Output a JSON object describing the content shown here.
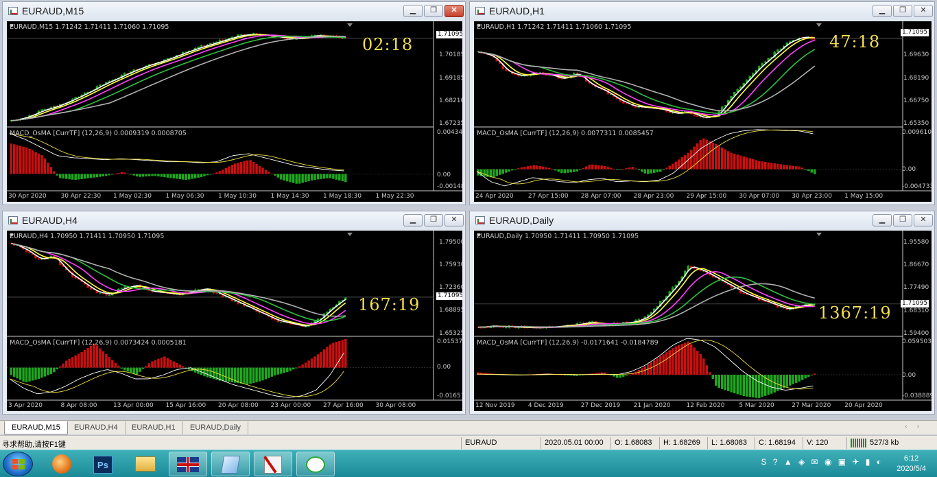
{
  "windows": [
    {
      "id": "w1",
      "title": "EURAUD,M15",
      "active": true,
      "info": "EURAUD,M15  1.71242 1.71411 1.71060 1.71095",
      "timer": "02:18",
      "price_box": "1.71095",
      "price_axis": [
        "1.70185",
        "1.69185",
        "1.68210",
        "1.67235"
      ],
      "macd_label": "MACD_OsMA [CurrTF] (12,26,9) 0.0009319 0.0008705",
      "macd_axis": [
        "0.0043417",
        "0.00",
        "-0.001481"
      ],
      "time_axis": [
        "30 Apr 2020",
        "30 Apr 22:30",
        "1 May 02:30",
        "1 May 06:30",
        "1 May 10:30",
        "1 May 14:30",
        "1 May 18:30",
        "1 May 22:30"
      ],
      "chart_data": {
        "type": "line",
        "title": "EURAUD,M15",
        "x": [
          "30 Apr 2020",
          "30 Apr 22:30",
          "1 May 02:30",
          "1 May 06:30",
          "1 May 10:30",
          "1 May 14:30",
          "1 May 18:30",
          "1 May 22:30"
        ],
        "ylim": [
          1.6724,
          1.714
        ],
        "close": [
          1.6745,
          1.6762,
          1.679,
          1.681,
          1.6838,
          1.687,
          1.6905,
          1.6935,
          1.6965,
          1.699,
          1.701,
          1.7035,
          1.706,
          1.708,
          1.71,
          1.712,
          1.7125,
          1.7118,
          1.711,
          1.7105,
          1.712,
          1.7115,
          1.7109
        ],
        "ma": [
          {
            "color": "#ffffff",
            "period_shift": 0
          },
          {
            "color": "#ffff40",
            "period_shift": 1
          },
          {
            "color": "#ff40ff",
            "period_shift": 3
          },
          {
            "color": "#30c040",
            "period_shift": 6
          },
          {
            "color": "#b0b0b0",
            "period_shift": 10
          }
        ],
        "macd_hist": [
          0.003,
          0.0026,
          0.0018,
          -0.0004,
          -0.0006,
          -0.0004,
          -0.0002,
          0.0002,
          -0.0003,
          -0.0002,
          -0.0004,
          -0.0006,
          -0.0003,
          0.0002,
          0.001,
          0.0014,
          0.0004,
          -0.0006,
          -0.001,
          -0.0006,
          -0.0004,
          -0.0008
        ],
        "macd_line": [
          0.004,
          0.0034,
          0.0026,
          0.0018,
          0.0016,
          0.0015,
          0.0014,
          0.0015,
          0.0014,
          0.0013,
          0.0012,
          0.0012,
          0.0011,
          0.0012,
          0.0018,
          0.002,
          0.0016,
          0.0012,
          0.0008,
          0.0006,
          0.0004,
          0.0003
        ],
        "macd_ylim": [
          -0.0016,
          0.0045
        ]
      }
    },
    {
      "id": "w2",
      "title": "EURAUD,H1",
      "active": false,
      "info": "EURAUD,H1  1.71242 1.71411 1.71060 1.71095",
      "timer": "47:18",
      "price_box": "1.71095",
      "price_axis": [
        "1.69630",
        "1.68190",
        "1.66750",
        "1.65350"
      ],
      "macd_label": "MACD_OsMA [CurrTF] (12,26,9) 0.0077311 0.0085457",
      "macd_axis": [
        "0.0096103",
        "0.00",
        "-0.004733"
      ],
      "time_axis": [
        "24 Apr 2020",
        "27 Apr 15:00",
        "28 Apr 07:00",
        "28 Apr 23:00",
        "29 Apr 15:00",
        "30 Apr 07:00",
        "30 Apr 23:00",
        "1 May 15:00"
      ],
      "chart_data": {
        "type": "line",
        "title": "EURAUD,H1",
        "x": [
          "24 Apr 2020",
          "27 Apr 15:00",
          "28 Apr 07:00",
          "28 Apr 23:00",
          "29 Apr 15:00",
          "30 Apr 07:00",
          "30 Apr 23:00",
          "1 May 15:00"
        ],
        "ylim": [
          1.653,
          1.716
        ],
        "close": [
          1.702,
          1.699,
          1.689,
          1.686,
          1.688,
          1.687,
          1.684,
          1.688,
          1.68,
          1.676,
          1.67,
          1.666,
          1.665,
          1.664,
          1.661,
          1.662,
          1.658,
          1.66,
          1.672,
          1.682,
          1.692,
          1.7,
          1.708,
          1.712,
          1.711
        ],
        "ma": [
          {
            "color": "#ffffff",
            "period_shift": 0
          },
          {
            "color": "#ffff40",
            "period_shift": 1
          },
          {
            "color": "#ff40ff",
            "period_shift": 3
          },
          {
            "color": "#30c040",
            "period_shift": 6
          },
          {
            "color": "#b0b0b0",
            "period_shift": 10
          }
        ],
        "macd_hist": [
          -0.0015,
          -0.002,
          -0.0008,
          0.0004,
          0.001,
          0.0004,
          -0.001,
          -0.0006,
          0.0012,
          0.0008,
          -0.0002,
          0.0006,
          -0.0012,
          -0.0006,
          0.0016,
          0.004,
          0.0075,
          0.006,
          0.004,
          0.003,
          0.002,
          0.0015,
          0.001,
          0.0006,
          -0.0012
        ],
        "macd_line": [
          -0.0005,
          -0.003,
          -0.004,
          -0.003,
          -0.002,
          -0.0025,
          -0.003,
          -0.0032,
          -0.0025,
          -0.0022,
          -0.003,
          -0.0028,
          -0.003,
          -0.0026,
          -0.001,
          0.002,
          0.005,
          0.007,
          0.0085,
          0.0092,
          0.0095,
          0.0094,
          0.0093,
          0.0092,
          0.0085
        ],
        "macd_ylim": [
          -0.005,
          0.0098
        ]
      }
    },
    {
      "id": "w3",
      "title": "EURAUD,H4",
      "active": false,
      "info": "EURAUD,H4  1.70950 1.71411 1.70950 1.71095",
      "timer": "167:19",
      "price_box": "1.71095",
      "price_axis": [
        "1.79500",
        "1.75930",
        "1.72360",
        "1.68895",
        "1.65325"
      ],
      "macd_label": "MACD_OsMA [CurrTF] (12,26,9) 0.0073424 0.0005181",
      "macd_axis": [
        "0.0153706",
        "0.00",
        "-0.016513"
      ],
      "time_axis": [
        "3 Apr 2020",
        "8 Apr 08:00",
        "13 Apr 00:00",
        "15 Apr 16:00",
        "20 Apr 08:00",
        "23 Apr 00:00",
        "27 Apr 16:00",
        "30 Apr 08:00"
      ],
      "chart_data": {
        "type": "line",
        "title": "EURAUD,H4",
        "x": [
          "3 Apr 2020",
          "8 Apr 08:00",
          "13 Apr 00:00",
          "15 Apr 16:00",
          "20 Apr 08:00",
          "23 Apr 00:00",
          "27 Apr 16:00",
          "30 Apr 08:00"
        ],
        "ylim": [
          1.652,
          1.8
        ],
        "close": [
          1.795,
          1.785,
          1.77,
          1.775,
          1.75,
          1.735,
          1.72,
          1.715,
          1.725,
          1.73,
          1.72,
          1.718,
          1.715,
          1.72,
          1.725,
          1.715,
          1.705,
          1.695,
          1.685,
          1.675,
          1.67,
          1.665,
          1.675,
          1.695,
          1.711
        ],
        "ma": [
          {
            "color": "#ffffff",
            "period_shift": 0
          },
          {
            "color": "#ffff40",
            "period_shift": 1
          },
          {
            "color": "#ff40ff",
            "period_shift": 3
          },
          {
            "color": "#30c040",
            "period_shift": 6
          },
          {
            "color": "#b0b0b0",
            "period_shift": 10
          }
        ],
        "macd_hist": [
          -0.004,
          -0.008,
          -0.006,
          -0.003,
          0.004,
          0.008,
          0.013,
          0.006,
          -0.001,
          -0.004,
          0.003,
          0.006,
          0.002,
          -0.002,
          -0.005,
          -0.007,
          -0.008,
          -0.009,
          -0.007,
          -0.004,
          -0.002,
          0.002,
          0.007,
          0.013,
          0.0153
        ],
        "macd_line": [
          -0.006,
          -0.011,
          -0.014,
          -0.013,
          -0.01,
          -0.006,
          -0.003,
          -0.001,
          -0.003,
          -0.006,
          -0.006,
          -0.004,
          -0.001,
          0.0,
          -0.003,
          -0.006,
          -0.009,
          -0.011,
          -0.013,
          -0.015,
          -0.016,
          -0.015,
          -0.012,
          -0.004,
          0.008
        ],
        "macd_ylim": [
          -0.017,
          0.016
        ]
      }
    },
    {
      "id": "w4",
      "title": "EURAUD,Daily",
      "active": false,
      "info": "EURAUD,Daily  1.70950 1.71411 1.70950 1.71095",
      "timer": "1367:19",
      "price_box": "1.71095",
      "price_axis": [
        "1.95580",
        "1.86670",
        "1.77490",
        "1.68310",
        "1.59400"
      ],
      "macd_label": "MACD_OsMA [CurrTF] (12,26,9) -0.0171641 -0.0184789",
      "macd_axis": [
        "0.0595038",
        "0.00",
        "-0.038889"
      ],
      "time_axis": [
        "12 Nov 2019",
        "4 Dec 2019",
        "27 Dec 2019",
        "21 Jan 2020",
        "12 Feb 2020",
        "5 Mar 2020",
        "27 Mar 2020",
        "20 Apr 2020"
      ],
      "chart_data": {
        "type": "line",
        "title": "EURAUD,Daily",
        "x": [
          "12 Nov 2019",
          "4 Dec 2019",
          "27 Dec 2019",
          "21 Jan 2020",
          "12 Feb 2020",
          "5 Mar 2020",
          "27 Mar 2020",
          "20 Apr 2020"
        ],
        "ylim": [
          1.59,
          1.96
        ],
        "close": [
          1.62,
          1.625,
          1.622,
          1.62,
          1.618,
          1.62,
          1.625,
          1.63,
          1.64,
          1.63,
          1.635,
          1.64,
          1.66,
          1.72,
          1.78,
          1.86,
          1.84,
          1.81,
          1.78,
          1.75,
          1.73,
          1.71,
          1.69,
          1.705,
          1.711
        ],
        "ma": [
          {
            "color": "#ffffff",
            "period_shift": 0
          },
          {
            "color": "#ffff40",
            "period_shift": 1
          },
          {
            "color": "#ff40ff",
            "period_shift": 3
          },
          {
            "color": "#30c040",
            "period_shift": 6
          },
          {
            "color": "#b0b0b0",
            "period_shift": 10
          }
        ],
        "macd_hist": [
          0.004,
          0.002,
          0.0,
          -0.001,
          0.001,
          0.002,
          0.0,
          -0.002,
          0.002,
          0.004,
          -0.006,
          0.002,
          0.015,
          0.03,
          0.045,
          0.054,
          0.03,
          -0.02,
          -0.028,
          -0.035,
          -0.038,
          -0.03,
          -0.02,
          -0.01,
          0.002
        ],
        "macd_line": [
          0.001,
          0.0005,
          0.0,
          -0.0005,
          0.0,
          0.001,
          0.0005,
          0.0,
          0.0005,
          0.001,
          0.0,
          0.005,
          0.015,
          0.03,
          0.048,
          0.059,
          0.056,
          0.045,
          0.025,
          0.005,
          -0.01,
          -0.02,
          -0.025,
          -0.022,
          -0.018
        ],
        "macd_ylim": [
          -0.04,
          0.06
        ]
      }
    }
  ],
  "tabs": [
    "EURAUD,M15",
    "EURAUD,H4",
    "EURAUD,H1",
    "EURAUD,Daily"
  ],
  "status": {
    "help": "寻求帮助,请按F1键",
    "symbol": "EURAUD",
    "datetime": "2020.05.01 00:00",
    "open": "O: 1.68083",
    "high": "H: 1.68269",
    "low": "L: 1.68083",
    "close": "C: 1.68194",
    "volume": "V: 120",
    "traffic": "527/3 kb"
  },
  "taskbar": {
    "apps": [
      "swirl-app-icon",
      "photoshop-icon",
      "folder-icon",
      "uk-flag-icon",
      "notepad-icon",
      "paint-icon",
      "wechat-icon"
    ],
    "photoshop_label": "Ps",
    "time": "6:12",
    "date": "2020/5/4"
  },
  "colors": {
    "bull": "#1fa81f",
    "bear": "#c81010",
    "macd_up": "#c81010",
    "macd_down": "#1fa81f",
    "timer": "#f3df4e"
  }
}
